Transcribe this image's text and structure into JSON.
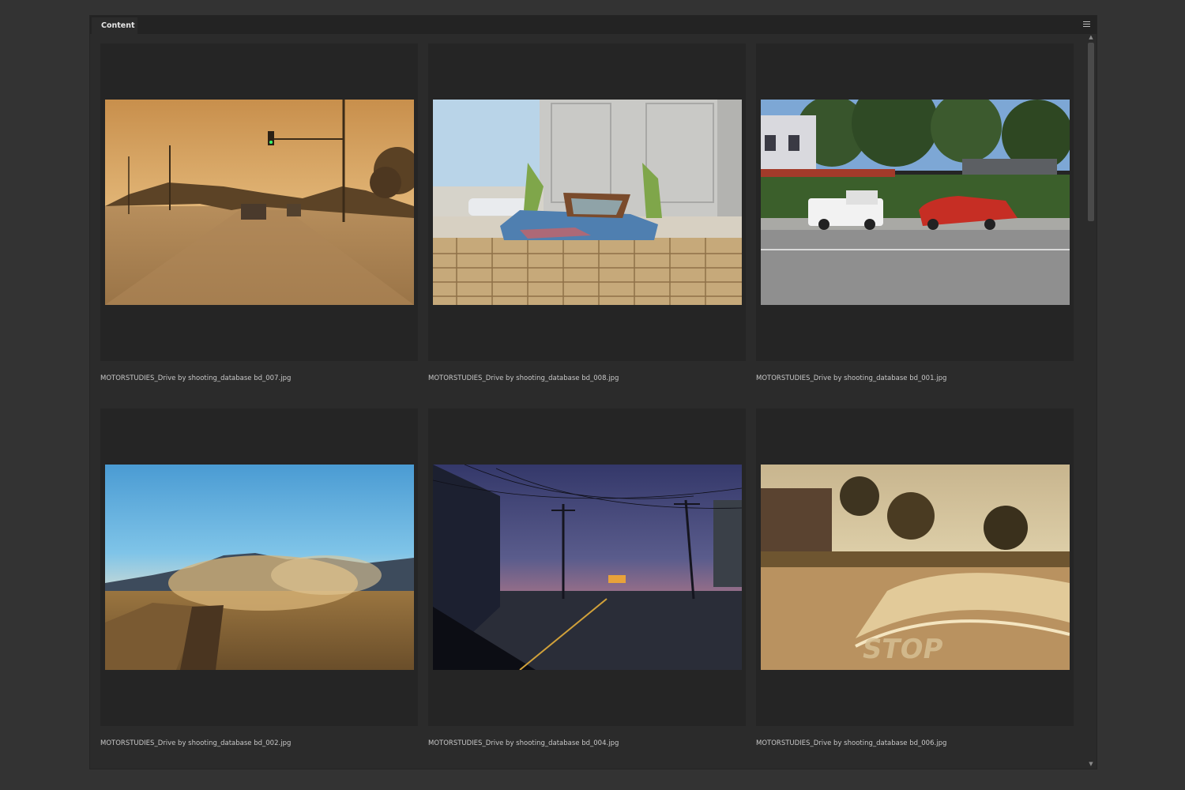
{
  "panel": {
    "tab_label": "Content",
    "menu_icon": "hamburger-icon"
  },
  "thumbnails": [
    {
      "filename": "MOTORSTUDIES_Drive by shooting_database bd_007.jpg",
      "scene": "sunset-street"
    },
    {
      "filename": "MOTORSTUDIES_Drive by shooting_database bd_008.jpg",
      "scene": "wrecked-convertible"
    },
    {
      "filename": "MOTORSTUDIES_Drive by shooting_database bd_001.jpg",
      "scene": "parked-truck-and-car"
    },
    {
      "filename": "MOTORSTUDIES_Drive by shooting_database bd_002.jpg",
      "scene": "desert-dust"
    },
    {
      "filename": "MOTORSTUDIES_Drive by shooting_database bd_004.jpg",
      "scene": "night-street"
    },
    {
      "filename": "MOTORSTUDIES_Drive by shooting_database bd_006.jpg",
      "scene": "stop-road"
    }
  ],
  "scrollbar": {
    "up_icon": "chevron-up-icon",
    "down_icon": "chevron-down-icon"
  }
}
